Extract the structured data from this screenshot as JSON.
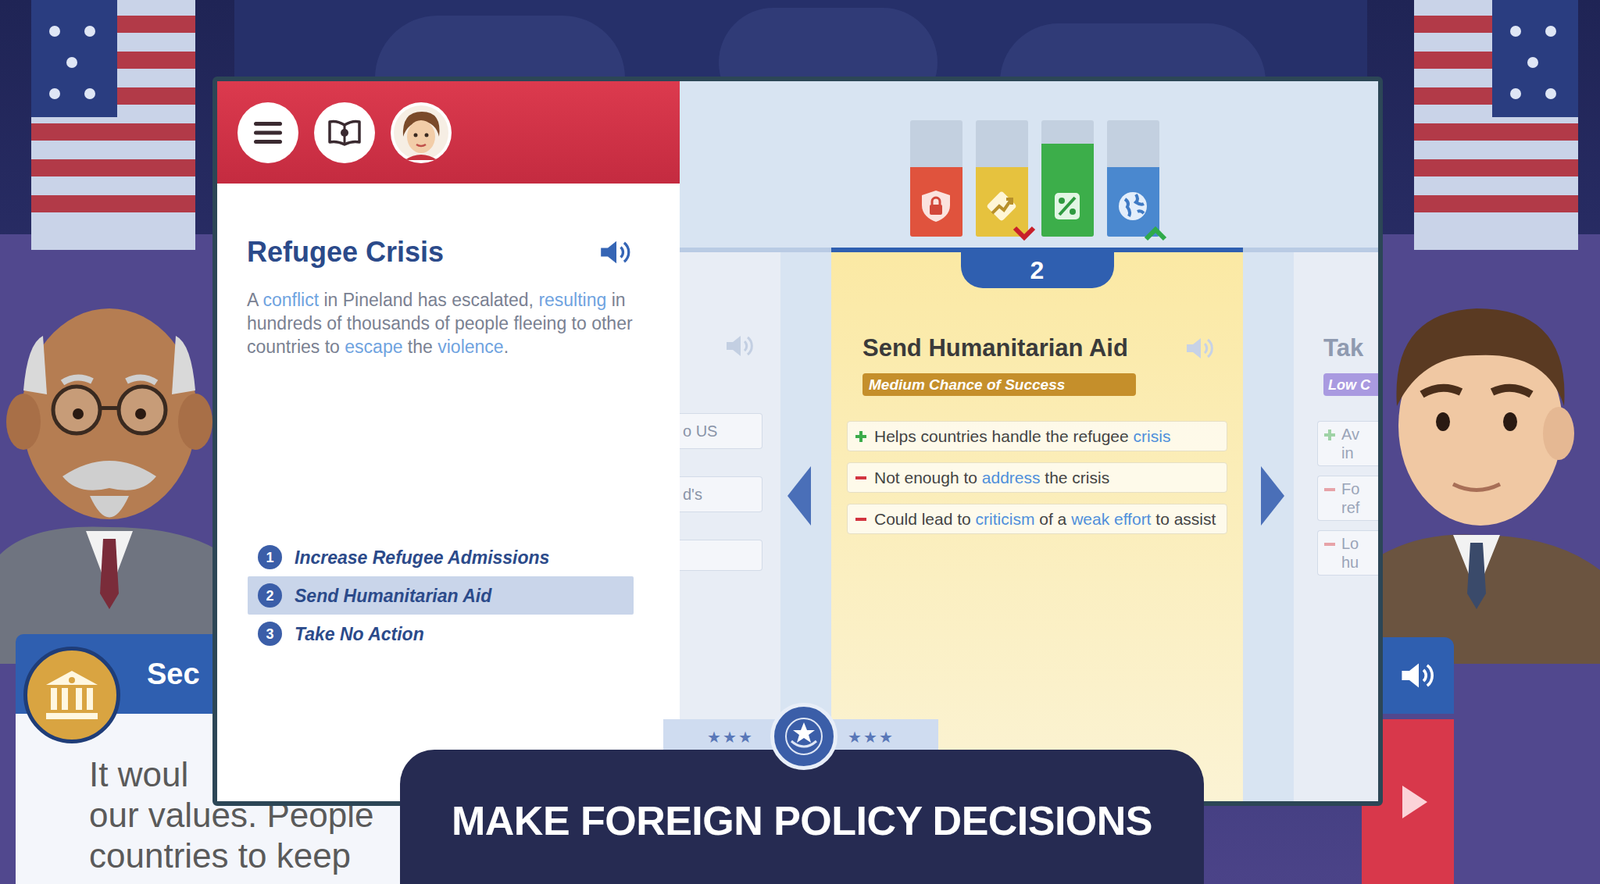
{
  "crisis": {
    "title": "Refugee Crisis",
    "description": [
      {
        "text": "A ",
        "glossary": false
      },
      {
        "text": "conflict",
        "glossary": true
      },
      {
        "text": " in Pineland has escalated, ",
        "glossary": false
      },
      {
        "text": "resulting",
        "glossary": true
      },
      {
        "text": " in hundreds of thousands of people fleeing to other countries to ",
        "glossary": false
      },
      {
        "text": "escape",
        "glossary": true
      },
      {
        "text": " the ",
        "glossary": false
      },
      {
        "text": "violence",
        "glossary": true
      },
      {
        "text": ".",
        "glossary": false
      }
    ],
    "options": [
      {
        "number": "1",
        "label": "Increase Refugee Admissions",
        "selected": false
      },
      {
        "number": "2",
        "label": "Send Humanitarian Aid",
        "selected": true
      },
      {
        "number": "3",
        "label": "Take No Action",
        "selected": false
      }
    ]
  },
  "meters": [
    {
      "kind": "security",
      "level": 0.6,
      "color": "#e0533d",
      "trend": "none"
    },
    {
      "kind": "economy",
      "level": 0.6,
      "color": "#e6c23e",
      "trend": "down"
    },
    {
      "kind": "health",
      "level": 0.8,
      "color": "#3cae4a",
      "trend": "none"
    },
    {
      "kind": "world",
      "level": 0.6,
      "color": "#4a88cf",
      "trend": "up"
    }
  ],
  "card": {
    "number": "2",
    "title": "Send Humanitarian Aid",
    "chance": "Medium Chance of Success",
    "points": [
      {
        "kind": "pro",
        "segments": [
          {
            "text": "Helps countries handle the refugee ",
            "glossary": false
          },
          {
            "text": "crisis",
            "glossary": true
          }
        ]
      },
      {
        "kind": "con",
        "segments": [
          {
            "text": "Not enough to ",
            "glossary": false
          },
          {
            "text": "address",
            "glossary": true
          },
          {
            "text": " the crisis",
            "glossary": false
          }
        ]
      },
      {
        "kind": "con",
        "segments": [
          {
            "text": "Could lead to ",
            "glossary": false
          },
          {
            "text": "criticism",
            "glossary": true
          },
          {
            "text": " of a ",
            "glossary": false
          },
          {
            "text": "weak effort",
            "glossary": true
          },
          {
            "text": " to assist",
            "glossary": false
          }
        ]
      }
    ]
  },
  "left_card": {
    "lines": [
      "o US",
      "d's"
    ]
  },
  "right_card": {
    "title": "Tak",
    "chance": "Low C",
    "points": [
      {
        "kind": "pro",
        "lines": [
          "Av",
          "in"
        ]
      },
      {
        "kind": "con",
        "lines": [
          "Fo",
          "ref"
        ]
      },
      {
        "kind": "con",
        "lines": [
          "Lo",
          "hu"
        ]
      }
    ]
  },
  "advisor": {
    "title": "Sec",
    "lines": [
      "It woul",
      "our values. People",
      "countries to keep"
    ]
  },
  "seal": {
    "stars_left": "★★★",
    "stars_right": "★★★"
  },
  "banner": "MAKE FOREIGN POLICY DECISIONS"
}
